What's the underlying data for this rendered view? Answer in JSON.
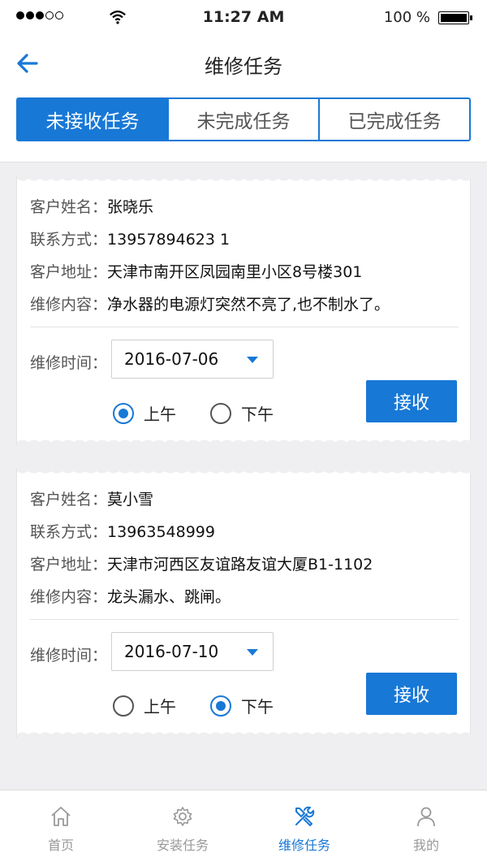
{
  "status_bar": {
    "time": "11:27 AM",
    "battery": "100 %"
  },
  "nav": {
    "title": "维修任务"
  },
  "tabs": [
    {
      "label": "未接收任务",
      "active": true
    },
    {
      "label": "未完成任务",
      "active": false
    },
    {
      "label": "已完成任务",
      "active": false
    }
  ],
  "cards": [
    {
      "name_label": "客户姓名：",
      "name": "张晓乐",
      "phone_label": "联系方式：",
      "phone": "13957894623 1",
      "address_label": "客户地址：",
      "address": "天津市南开区凤园南里小区8号楼301",
      "content_label": "维修内容：",
      "content": "净水器的电源灯突然不亮了,也不制水了。",
      "time_label": "维修时间：",
      "date": "2016-07-06",
      "am_label": "上午",
      "pm_label": "下午",
      "selected": "am",
      "accept_label": "接收"
    },
    {
      "name_label": "客户姓名：",
      "name": "莫小雪",
      "phone_label": "联系方式：",
      "phone": "13963548999",
      "address_label": "客户地址：",
      "address": "天津市河西区友谊路友谊大厦B1-1102",
      "content_label": "维修内容：",
      "content": "龙头漏水、跳闸。",
      "time_label": "维修时间：",
      "date": "2016-07-10",
      "am_label": "上午",
      "pm_label": "下午",
      "selected": "pm",
      "accept_label": "接收"
    }
  ],
  "tab_bar": [
    {
      "label": "首页",
      "icon": "home-icon"
    },
    {
      "label": "安装任务",
      "icon": "gear-icon"
    },
    {
      "label": "维修任务",
      "icon": "tools-icon",
      "active": true
    },
    {
      "label": "我的",
      "icon": "user-icon"
    }
  ],
  "colors": {
    "accent": "#1878d6"
  }
}
